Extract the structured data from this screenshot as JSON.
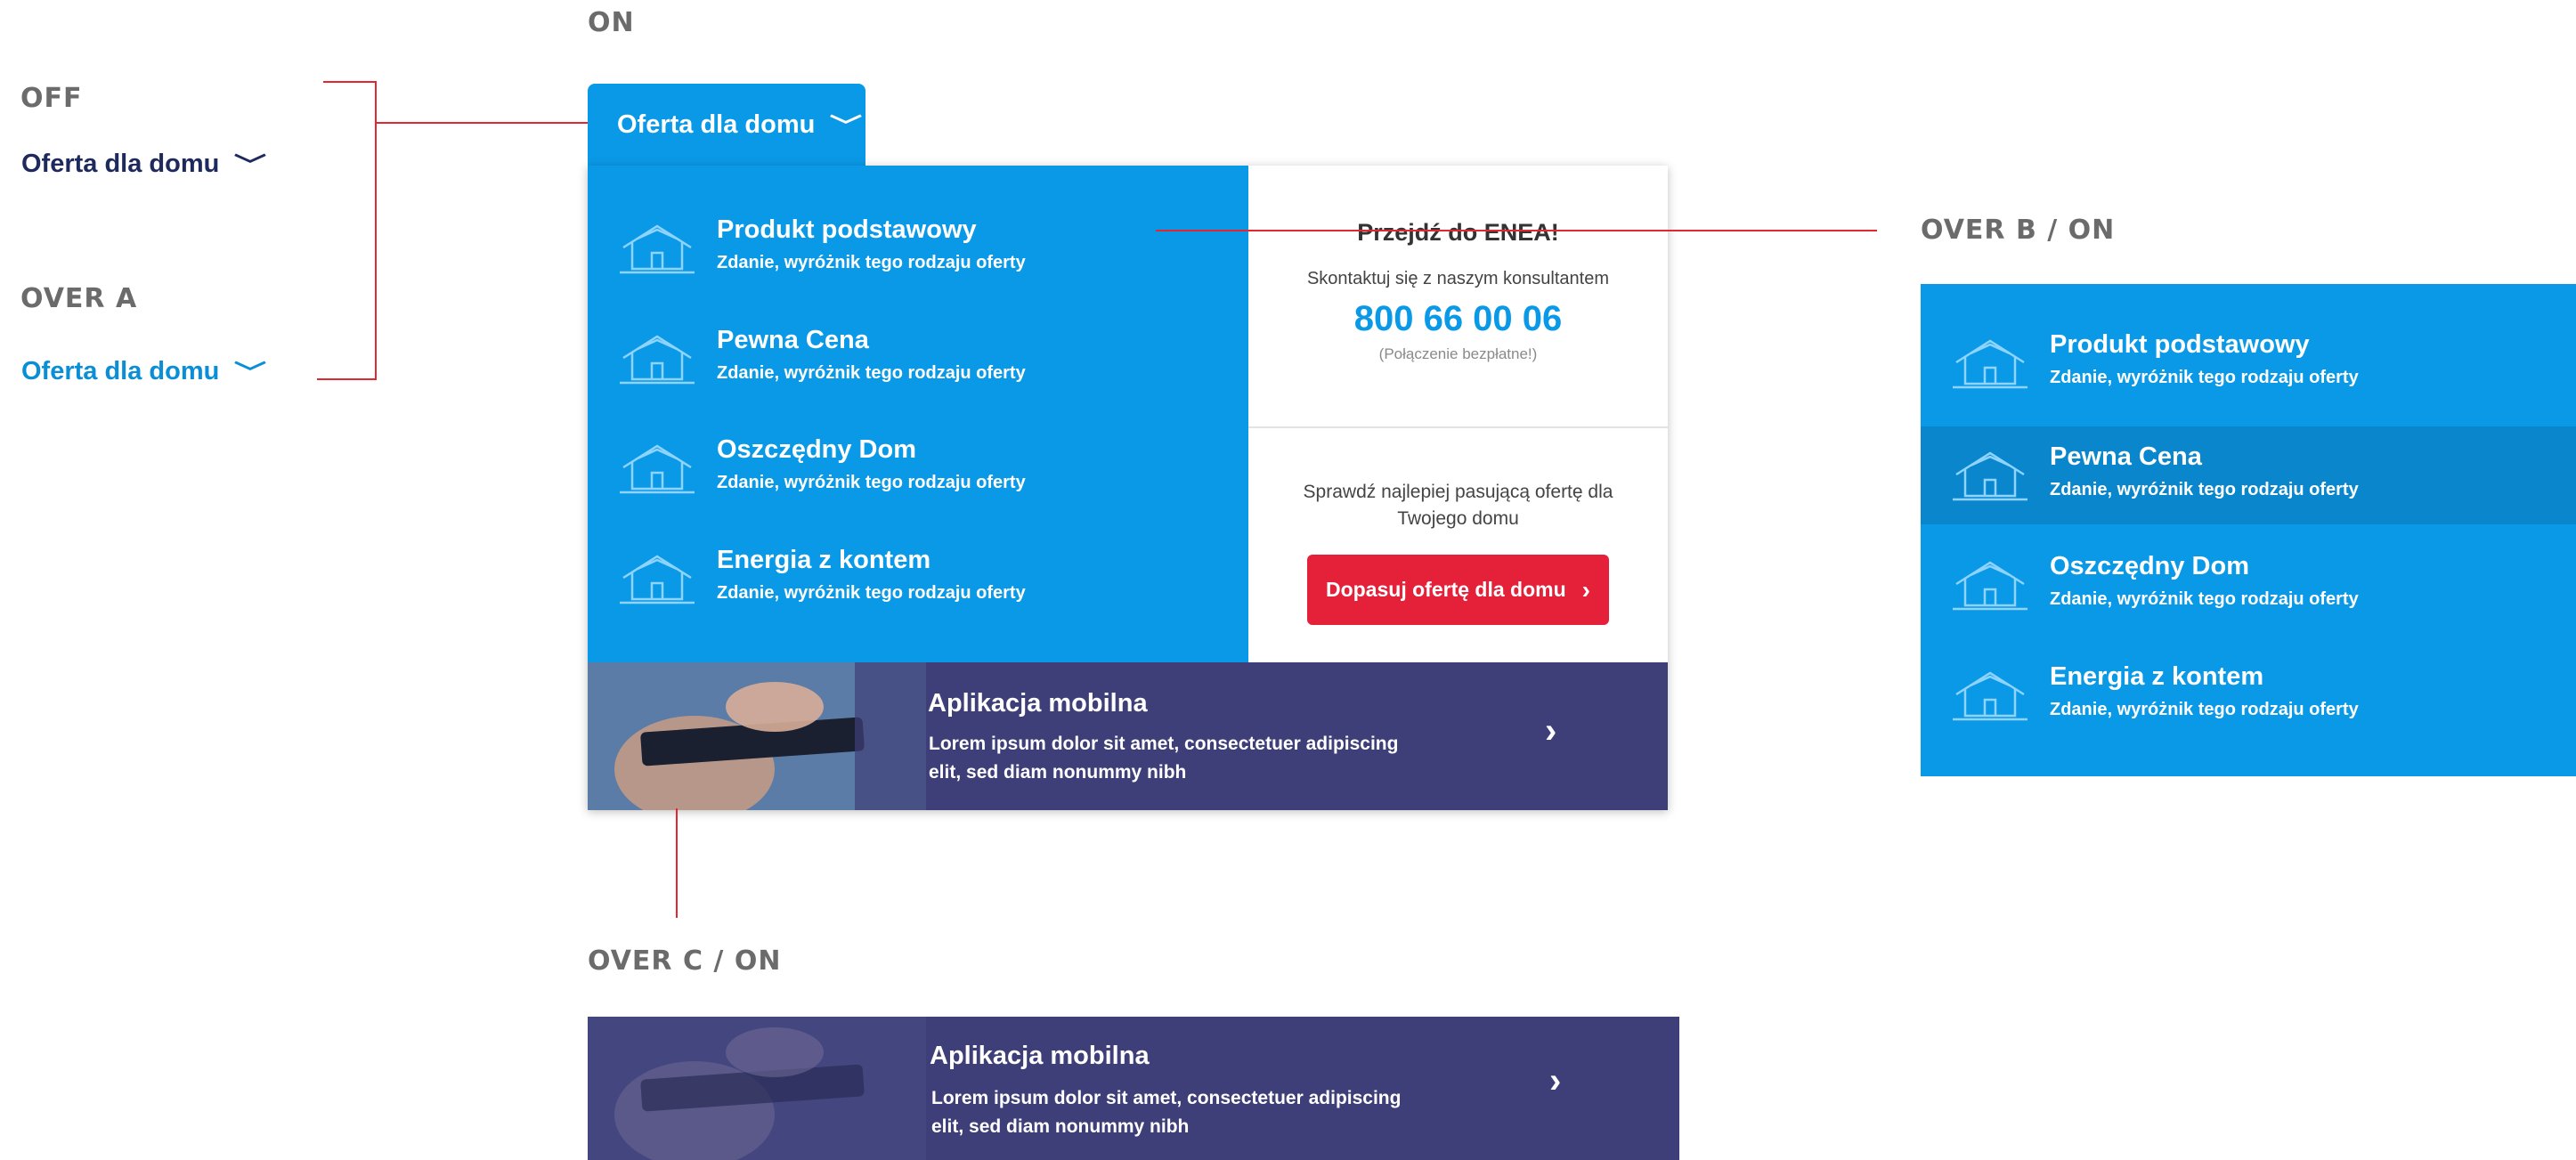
{
  "states": {
    "on": "ON",
    "off": "OFF",
    "over_a": "OVER A",
    "over_b_on": "OVER B / ON",
    "over_c_on": "OVER C / ON"
  },
  "nav": {
    "label": "Oferta dla domu",
    "chevron": "﹀"
  },
  "colors": {
    "brand_blue": "#0a99e6",
    "hover_blue": "#0a86cd",
    "nav_dark": "#1e2a5e",
    "link_blue": "#0a8fd6",
    "banner_purple": "#3e3f78",
    "cta_red": "#e5213a",
    "annotation_red": "#e3262f"
  },
  "menu": {
    "items": [
      {
        "title": "Produkt podstawowy",
        "subtitle": "Zdanie, wyróżnik tego rodzaju oferty",
        "icon": "house-icon"
      },
      {
        "title": "Pewna Cena",
        "subtitle": "Zdanie, wyróżnik tego rodzaju oferty",
        "icon": "house-icon"
      },
      {
        "title": "Oszczędny Dom",
        "subtitle": "Zdanie, wyróżnik tego rodzaju oferty",
        "icon": "house-icon"
      },
      {
        "title": "Energia z kontem",
        "subtitle": "Zdanie, wyróżnik tego rodzaju oferty",
        "icon": "house-icon"
      }
    ]
  },
  "contact": {
    "title": "Przejdź do ENEA!",
    "subtitle": "Skontaktuj się z naszym konsultantem",
    "phone": "800 66 00 06",
    "note": "(Połączenie bezpłatne!)"
  },
  "match": {
    "text": "Sprawdź najlepiej pasującą ofertę dla Twojego domu",
    "button": "Dopasuj ofertę dla domu",
    "button_arrow": "›"
  },
  "mobile": {
    "title": "Aplikacja mobilna",
    "description": "Lorem ipsum dolor sit amet, consectetuer adipiscing elit, sed diam nonummy nibh",
    "arrow": "›"
  }
}
